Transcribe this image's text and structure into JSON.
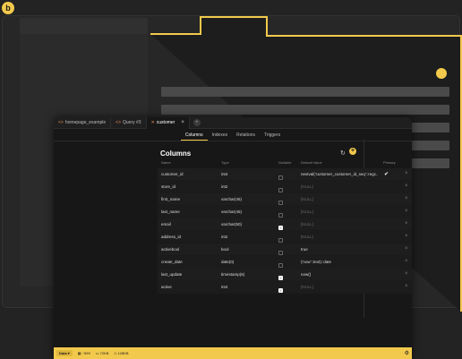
{
  "tabs": [
    {
      "label": "homepage_example",
      "icon": "code-icon",
      "active": false
    },
    {
      "label": "Query #3",
      "icon": "code-icon",
      "active": false
    },
    {
      "label": "customer",
      "icon": "table-icon",
      "active": true
    }
  ],
  "subtabs": [
    "Columns",
    "Indexes",
    "Relations",
    "Triggers"
  ],
  "active_subtab": "Columns",
  "heading": "Columns",
  "headers": {
    "name": "Name",
    "type": "Type",
    "nullable": "Nullable",
    "default": "Default Value",
    "primary": "Primary"
  },
  "rows": [
    {
      "name": "customer_id",
      "type": "int4",
      "nullable": false,
      "default": "nextval('customer_customer_id_seq'::regc...",
      "default_null": false,
      "primary": true
    },
    {
      "name": "store_id",
      "type": "int2",
      "nullable": false,
      "default": "[NULL]",
      "default_null": true,
      "primary": false
    },
    {
      "name": "first_name",
      "type": "varchar(45)",
      "nullable": false,
      "default": "[NULL]",
      "default_null": true,
      "primary": false
    },
    {
      "name": "last_name",
      "type": "varchar(45)",
      "nullable": false,
      "default": "[NULL]",
      "default_null": true,
      "primary": false
    },
    {
      "name": "email",
      "type": "varchar(50)",
      "nullable": true,
      "default": "[NULL]",
      "default_null": true,
      "primary": false
    },
    {
      "name": "address_id",
      "type": "int2",
      "nullable": false,
      "default": "[NULL]",
      "default_null": true,
      "primary": false
    },
    {
      "name": "activebool",
      "type": "bool",
      "nullable": false,
      "default": "true",
      "default_null": false,
      "primary": false
    },
    {
      "name": "create_date",
      "type": "date(0)",
      "nullable": false,
      "default": "('now'::text)::date",
      "default_null": false,
      "primary": false
    },
    {
      "name": "last_update",
      "type": "timestamp(6)",
      "nullable": true,
      "default": "now()",
      "default_null": false,
      "primary": false
    },
    {
      "name": "active",
      "type": "int4",
      "nullable": true,
      "default": "[NULL]",
      "default_null": true,
      "primary": false
    }
  ],
  "statusbar": {
    "mode": "Data",
    "rows": "~599",
    "size1": "72KB",
    "size2": "128KB"
  },
  "colors": {
    "accent": "#f2c94c",
    "background": "#171717"
  }
}
